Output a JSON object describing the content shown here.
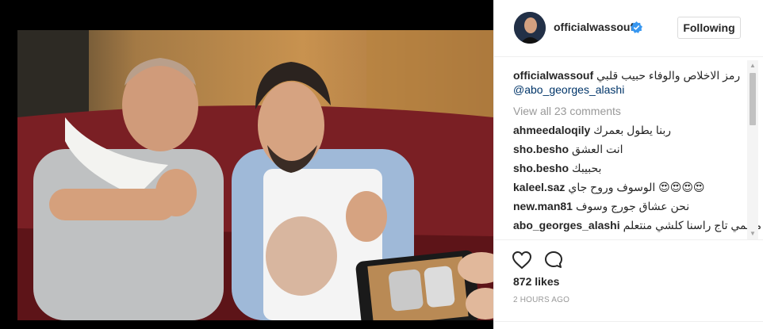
{
  "post": {
    "username": "officialwassouf",
    "follow_label": "Following",
    "caption_user": "officialwassouf",
    "caption_text": "رمز الاخلاص والوفاء حبيب قلبي",
    "caption_mention": "@abo_georges_alashi",
    "view_all": "View all 23 comments",
    "likes": "872 likes",
    "time": "2 HOURS AGO"
  },
  "comments": [
    {
      "user": "ahmeedaloqily",
      "text": "ربنا يطول بعمرك"
    },
    {
      "user": "sho.besho",
      "text": "انت العشق"
    },
    {
      "user": "sho.besho",
      "text": "بحبيبك"
    },
    {
      "user": "kaleel.saz",
      "text": "الوسوف وروح جاي 😍😍😍😍"
    },
    {
      "user": "new.man81",
      "text": "نحن عشاق جورج وسوف"
    },
    {
      "user": "abo_georges_alashi",
      "text": "معلمي تاج راسنا كلشي منتعلم"
    }
  ],
  "icons": {
    "verified": "verified-badge-icon",
    "like": "heart-icon",
    "comment": "comment-bubble-icon"
  },
  "colors": {
    "accent_blue": "#3897f0",
    "link": "#003569",
    "muted": "#999999"
  }
}
